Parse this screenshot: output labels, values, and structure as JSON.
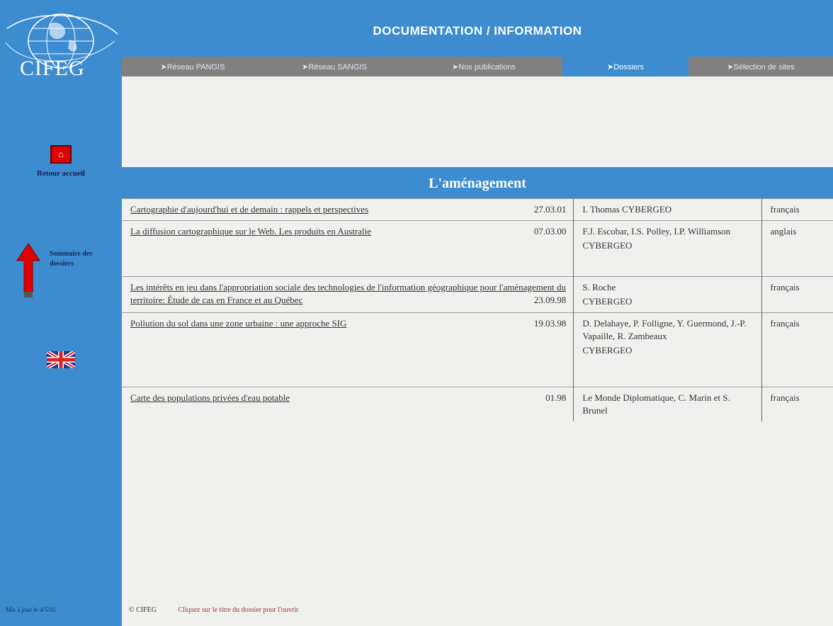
{
  "logo": {
    "text": "CIFEG"
  },
  "sidebar": {
    "home_label": "Retour accueil",
    "summary_label": "Sommaire des dossiers",
    "update_text": "Mis à jour le 4/5/01"
  },
  "header": {
    "title": "DOCUMENTATION / INFORMATION"
  },
  "nav": {
    "items": [
      {
        "label": "➤Réseau PANGIS"
      },
      {
        "label": "➤Réseau SANGIS"
      },
      {
        "label": "➤Nos publications"
      },
      {
        "label": "➤Dossiers"
      },
      {
        "label": "➤Sélection de sites"
      }
    ],
    "active_index": 3
  },
  "section": {
    "title": "L'aménagement"
  },
  "documents": [
    {
      "title": "Cartographie d'aujourd'hui et de demain : rappels et perspectives",
      "date": "27.03.01",
      "authors": "I. Thomas",
      "journal": "CYBERGEO",
      "language": "français"
    },
    {
      "title": "La diffusion cartographique sur le Web. Les produits en Australie",
      "date": "07.03.00",
      "authors": "F.J. Escobar, I.S. Polley, I.P. Williamson",
      "journal": "CYBERGEO",
      "language": "anglais"
    },
    {
      "title": "Les intérêts en jeu dans l'appropriation sociale des technologies de l'information géographique pour l'aménagement du territoire: Étude de cas en France et au Québec",
      "date": "23.09.98",
      "authors": "S. Roche",
      "journal": "CYBERGEO",
      "language": "français"
    },
    {
      "title": "Pollution du sol dans une zone urbaine : une approche SIG",
      "date": "19.03.98",
      "authors": "D. Delahaye, P. Folligne, Y. Guermond, J.-P. Vapaille, R. Zambeaux",
      "journal": "CYBERGEO",
      "language": "français"
    },
    {
      "title": "Carte des populations privées d'eau potable",
      "date": "01.98",
      "authors": "Le Monde Diplomatique, C. Marin et S. Brunel",
      "journal": "",
      "language": "français"
    }
  ],
  "footer": {
    "copyright": "© CIFEG",
    "hint": "Cliquez sur le titre du dossier pour l'ouvrir"
  },
  "colors": {
    "brand_blue": "#3c8ccf",
    "nav_gray": "#808080",
    "background": "#f0f0ee"
  }
}
